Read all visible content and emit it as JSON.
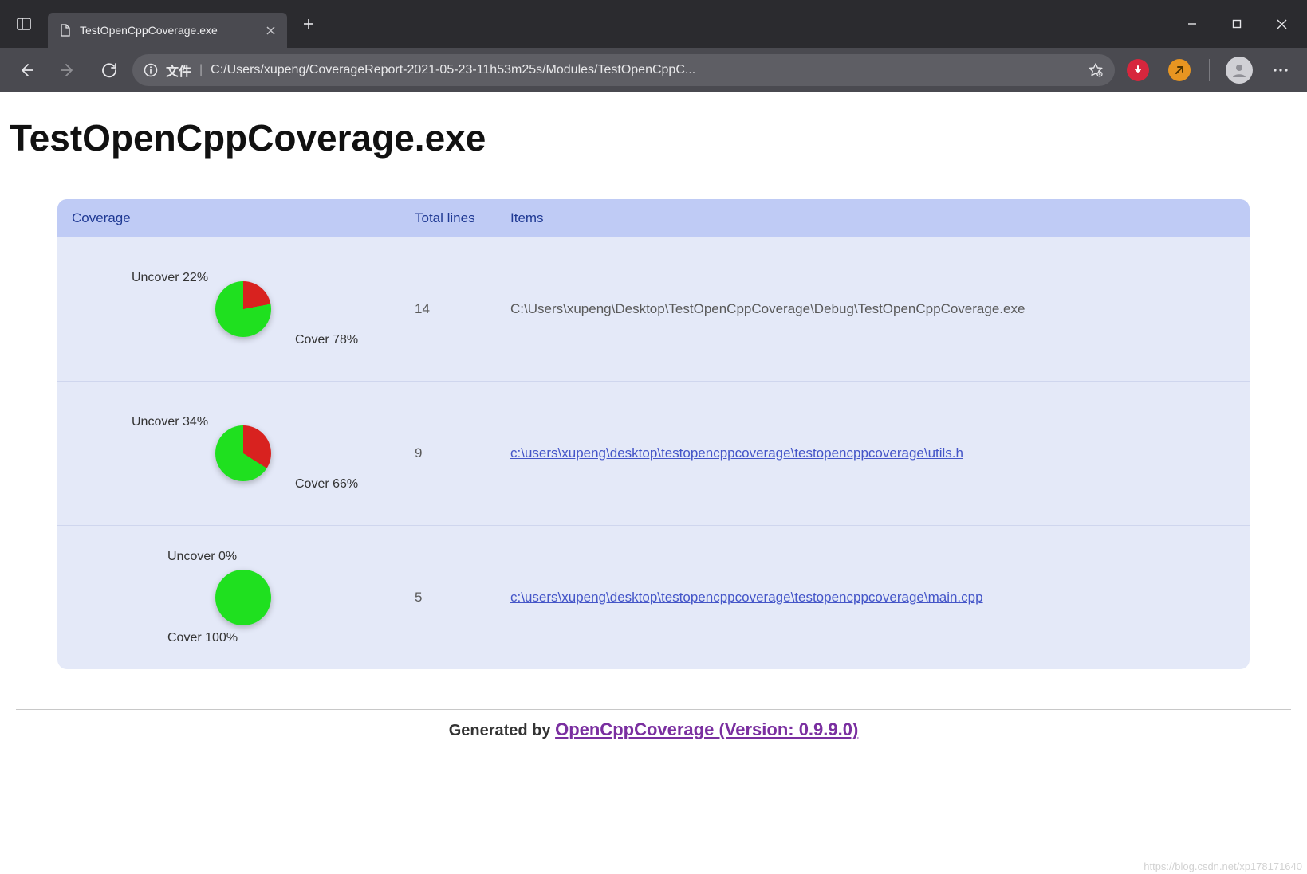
{
  "browser": {
    "tab_title": "TestOpenCppCoverage.exe",
    "address_type_label": "文件",
    "address_url": "C:/Users/xupeng/CoverageReport-2021-05-23-11h53m25s/Modules/TestOpenCppC..."
  },
  "page": {
    "title": "TestOpenCppCoverage.exe",
    "footer_prefix": "Generated by ",
    "footer_link": "OpenCppCoverage (Version: 0.9.9.0)",
    "watermark": "https://blog.csdn.net/xp178171640"
  },
  "table": {
    "headers": {
      "coverage": "Coverage",
      "total_lines": "Total lines",
      "items": "Items"
    },
    "rows": [
      {
        "cover": 78,
        "uncover": 22,
        "cover_label": "Cover 78%",
        "uncover_label": "Uncover 22%",
        "total_lines": "14",
        "item_text": "C:\\Users\\xupeng\\Desktop\\TestOpenCppCoverage\\Debug\\TestOpenCppCoverage.exe",
        "item_is_link": false
      },
      {
        "cover": 66,
        "uncover": 34,
        "cover_label": "Cover 66%",
        "uncover_label": "Uncover 34%",
        "total_lines": "9",
        "item_text": "c:\\users\\xupeng\\desktop\\testopencppcoverage\\testopencppcoverage\\utils.h",
        "item_is_link": true
      },
      {
        "cover": 100,
        "uncover": 0,
        "cover_label": "Cover 100%",
        "uncover_label": "Uncover 0%",
        "total_lines": "5",
        "item_text": "c:\\users\\xupeng\\desktop\\testopencppcoverage\\testopencppcoverage\\main.cpp",
        "item_is_link": true
      }
    ]
  },
  "chart_data": [
    {
      "type": "pie",
      "title": "",
      "series": [
        {
          "name": "Cover",
          "value": 78
        },
        {
          "name": "Uncover",
          "value": 22
        }
      ]
    },
    {
      "type": "pie",
      "title": "",
      "series": [
        {
          "name": "Cover",
          "value": 66
        },
        {
          "name": "Uncover",
          "value": 34
        }
      ]
    },
    {
      "type": "pie",
      "title": "",
      "series": [
        {
          "name": "Cover",
          "value": 100
        },
        {
          "name": "Uncover",
          "value": 0
        }
      ]
    }
  ]
}
